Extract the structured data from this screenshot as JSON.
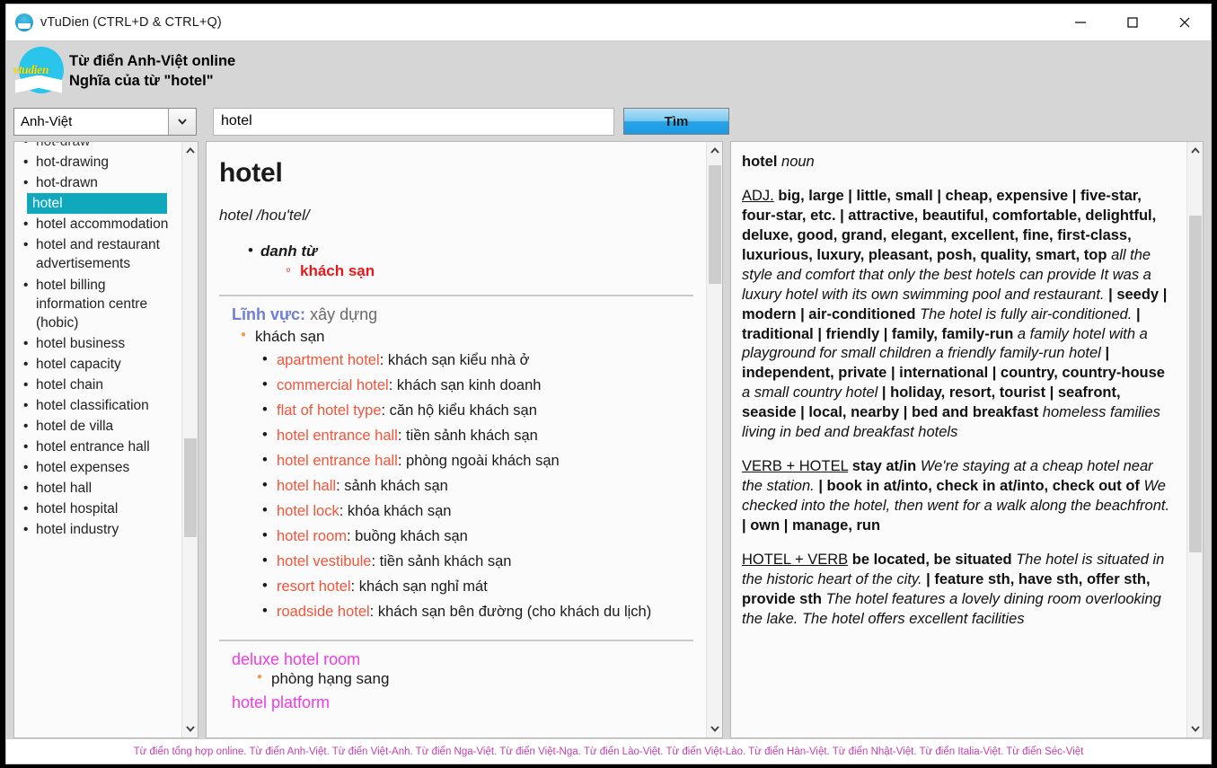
{
  "window": {
    "title": "vTuDien (CTRL+D & CTRL+Q)",
    "app_icon": "vtudien-circle-icon",
    "minimize_label": "—",
    "maximize_label": "□",
    "close_label": "✕"
  },
  "brand": {
    "wordmark": "vtudien",
    "line1": "Từ điển Anh-Việt online",
    "line2": "Nghĩa của từ \"hotel\""
  },
  "search": {
    "dictionary_value": "Anh-Việt",
    "query_value": "hotel",
    "query_placeholder": "",
    "find_label": "Tìm"
  },
  "wordlist": {
    "clipped_top": "hot-draw",
    "selected": "hotel",
    "items": [
      "hot-drawing",
      "hot-drawn",
      "hotel",
      "hotel accommodation",
      "hotel and restaurant advertisements",
      "hotel billing information centre (hobic)",
      "hotel business",
      "hotel capacity",
      "hotel chain",
      "hotel classification",
      "hotel de villa",
      "hotel entrance hall",
      "hotel expenses",
      "hotel hall",
      "hotel hospital",
      "hotel industry"
    ]
  },
  "entry": {
    "headword": "hotel",
    "phonetic": "hotel /hou'tel/",
    "part_of_speech": "danh từ",
    "sense": "khách sạn",
    "field_label": "Lĩnh vực:",
    "field_value": "xây dựng",
    "field_head": "khách sạn",
    "collocations": [
      {
        "en": "apartment hotel",
        "vi": "khách sạn kiểu nhà ở"
      },
      {
        "en": "commercial hotel",
        "vi": "khách sạn kinh doanh"
      },
      {
        "en": "flat of hotel type",
        "vi": "căn hộ kiểu khách sạn"
      },
      {
        "en": "hotel entrance hall",
        "vi": "tiền sảnh khách sạn"
      },
      {
        "en": "hotel entrance hall",
        "vi": "phòng ngoài khách sạn"
      },
      {
        "en": "hotel hall",
        "vi": "sảnh khách sạn"
      },
      {
        "en": "hotel lock",
        "vi": "khóa khách sạn"
      },
      {
        "en": "hotel room",
        "vi": "buồng khách sạn"
      },
      {
        "en": "hotel vestibule",
        "vi": "tiền sảnh khách sạn"
      },
      {
        "en": "resort hotel",
        "vi": "khách sạn nghỉ mát"
      },
      {
        "en": "roadside hotel",
        "vi": "khách sạn bên đường (cho khách du lịch)"
      }
    ],
    "subentry_1_title": "deluxe hotel room",
    "subentry_1_def": "phòng hạng sang",
    "subentry_2_title": "hotel platform"
  },
  "collocation_pane": {
    "headword": "hotel",
    "headword_pos": "noun",
    "adj_label": "ADJ.",
    "adj_body_1": "big, large | little, small | cheap, expensive | five-star, four-star, etc. | attractive, beautiful, comfortable, delightful, deluxe, good, grand, elegant, excellent, fine, first-class, luxurious, luxury, pleasant, posh, quality, smart, top",
    "adj_italic_1": "all the style and comfort that only the best hotels can provide It was a luxury hotel with its own swimming pool and restaurant.",
    "adj_body_2": "| seedy | modern | air-conditioned",
    "adj_italic_2": "The hotel is fully air-conditioned.",
    "adj_body_3": "| traditional | friendly | family, family-run",
    "adj_italic_3": "a family hotel with a playground for small children a friendly family-run hotel",
    "adj_body_4": "| independent, private | international | country, country-house",
    "adj_italic_4": "a small country hotel",
    "adj_body_5": "| holiday, resort, tourist | seafront, seaside | local, nearby | bed and breakfast",
    "adj_italic_5": "homeless families living in bed and breakfast hotels",
    "verb_hotel_label": "VERB + HOTEL",
    "verb_hotel_body_1": "stay at/in",
    "verb_hotel_italic_1": "We're staying at a cheap hotel near the station.",
    "verb_hotel_body_2": "| book in at/into, check in at/into, check out of",
    "verb_hotel_italic_2": "We checked into the hotel, then went for a walk along the beachfront.",
    "verb_hotel_body_3": "| own | manage, run",
    "hotel_verb_label": "HOTEL + VERB",
    "hotel_verb_body_1": "be located, be situated",
    "hotel_verb_italic_1": "The hotel is situated in the historic heart of the city.",
    "hotel_verb_body_2": "| feature sth, have sth, offer sth, provide sth",
    "hotel_verb_italic_2": "The hotel features a lovely dining room overlooking the lake. The hotel offers excellent facilities"
  },
  "footer": {
    "text": "Từ điển tổng hợp online. Từ điển Anh-Việt. Từ điển Việt-Anh. Từ điển Nga-Việt. Từ điển Việt-Nga. Từ điển Lào-Việt. Từ điển Việt-Lào. Từ điển Hàn-Việt. Từ điển Nhật-Việt. Từ điển Italia-Việt. Từ điển Séc-Việt"
  },
  "colors": {
    "selection": "#0fa8bd",
    "sense_red": "#e8191a",
    "colloc_orange": "#f2553a",
    "subentry_magenta": "#ef3ce5",
    "field_blue": "#6f7fd6",
    "footer_purple": "#c23fb0",
    "button_blue": "#27a3e8"
  }
}
